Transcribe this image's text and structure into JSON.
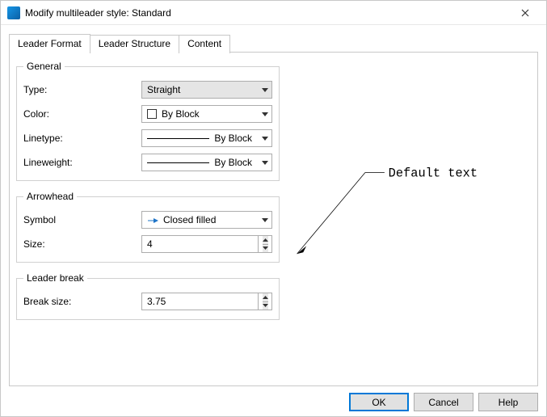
{
  "window": {
    "title": "Modify multileader style: Standard"
  },
  "tabs": {
    "leader_format": "Leader Format",
    "leader_structure": "Leader Structure",
    "content": "Content"
  },
  "groups": {
    "general": {
      "legend": "General",
      "type_label": "Type:",
      "type_value": "Straight",
      "color_label": "Color:",
      "color_value": "By Block",
      "linetype_label": "Linetype:",
      "linetype_value": "By Block",
      "lineweight_label": "Lineweight:",
      "lineweight_value": "By Block"
    },
    "arrowhead": {
      "legend": "Arrowhead",
      "symbol_label": "Symbol",
      "symbol_value": "Closed filled",
      "size_label": "Size:",
      "size_value": "4"
    },
    "leader_break": {
      "legend": "Leader break",
      "break_size_label": "Break size:",
      "break_size_value": "3.75"
    }
  },
  "preview": {
    "text": "Default text"
  },
  "buttons": {
    "ok": "OK",
    "cancel": "Cancel",
    "help": "Help"
  }
}
